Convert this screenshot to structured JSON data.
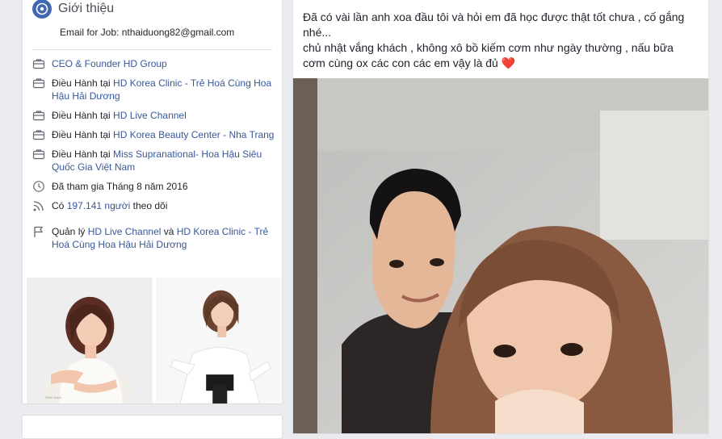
{
  "intro": {
    "title": "Giới thiệu",
    "email": "Email for Job: nthaiduong82@gmail.com",
    "rows": [
      {
        "icon": "briefcase-icon",
        "parts": [
          {
            "t": "CEO & Founder HD Group",
            "link": true
          }
        ]
      },
      {
        "icon": "briefcase-icon",
        "parts": [
          {
            "t": "Điều Hành tại ",
            "link": false
          },
          {
            "t": "HD Korea Clinic - Trẻ Hoá Cùng Hoa Hậu Hải Dương",
            "link": true
          }
        ]
      },
      {
        "icon": "briefcase-icon",
        "parts": [
          {
            "t": "Điều Hành tại ",
            "link": false
          },
          {
            "t": "HD Live Channel",
            "link": true
          }
        ]
      },
      {
        "icon": "briefcase-icon",
        "parts": [
          {
            "t": "Điều Hành tại ",
            "link": false
          },
          {
            "t": "HD Korea Beauty Center - Nha Trang",
            "link": true
          }
        ]
      },
      {
        "icon": "briefcase-icon",
        "parts": [
          {
            "t": "Điều Hành tại ",
            "link": false
          },
          {
            "t": "Miss Supranational- Hoa Hậu Siêu Quốc Gia Việt Nam",
            "link": true
          }
        ]
      },
      {
        "icon": "clock-icon",
        "parts": [
          {
            "t": "Đã tham gia Tháng 8 năm 2016",
            "link": false
          }
        ]
      },
      {
        "icon": "rss-icon",
        "parts": [
          {
            "t": "Có ",
            "link": false
          },
          {
            "t": "197.141 người",
            "link": true
          },
          {
            "t": " theo dõi",
            "link": false
          }
        ]
      },
      {
        "icon": "flag-icon",
        "parts": [
          {
            "t": "Quản lý ",
            "link": false
          },
          {
            "t": "HD Live Channel",
            "link": true
          },
          {
            "t": " và ",
            "link": false
          },
          {
            "t": "HD Korea Clinic - Trẻ Hoá Cùng Hoa Hậu Hải Dương",
            "link": true
          }
        ]
      }
    ],
    "photos": [
      "photo-woman-sitting",
      "photo-woman-white-shirt"
    ]
  },
  "post": {
    "lines": [
      "Đã có vài lần anh xoa đầu tôi và hỏi em đã học được thật tốt chưa , cố gắng nhé...",
      "chủ nhật vắng khách , không xô bồ kiếm cơm như ngày thường , nấu bữa cơm cùng ox các con các em vậy là đủ"
    ],
    "emoji": "❤️",
    "photo": "selfie-couple-photo"
  },
  "colors": {
    "link": "#385898",
    "text": "#1d2129",
    "bg": "#e9ebee",
    "accent": "#4267b2"
  }
}
